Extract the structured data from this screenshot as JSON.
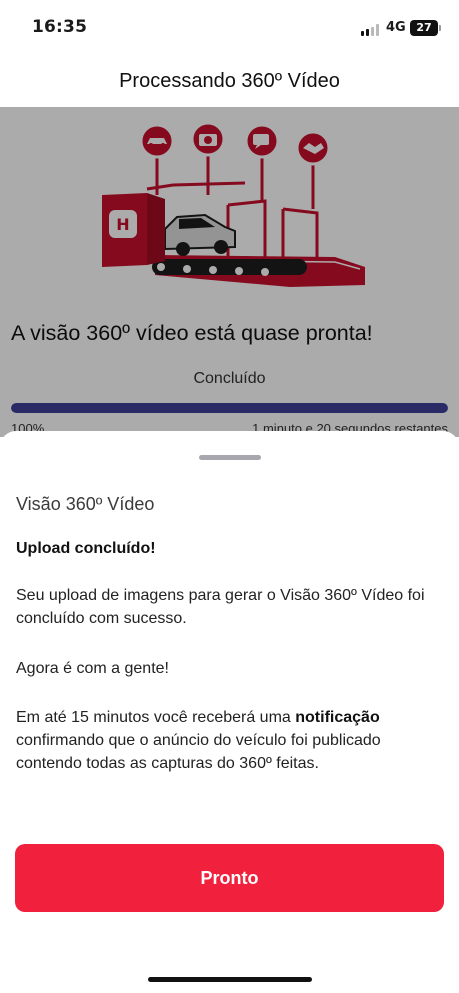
{
  "status_bar": {
    "time": "16:35",
    "network": "4G",
    "battery": "27"
  },
  "header": {
    "title": "Processando 360º Vídeo"
  },
  "processing": {
    "headline": "A visão 360º vídeo está quase pronta!",
    "status": "Concluído",
    "progress_fraction": 1.0,
    "percent_label": "100%",
    "eta_label": "1 minuto e 20 segundos restantes",
    "illustration_icons": [
      "car-icon",
      "camera-icon",
      "chat-icon",
      "handshake-icon"
    ]
  },
  "sheet": {
    "title": "Visão 360º Vídeo",
    "subtitle": "Upload concluído!",
    "paragraph_1": "Seu upload de imagens para gerar o Visão 360º Vídeo foi concluído com sucesso.",
    "paragraph_2": "Agora é com a gente!",
    "paragraph_3_prefix": "Em até 15 minutos você receberá uma ",
    "paragraph_3_bold": "notificação",
    "paragraph_3_suffix": " confirmando que o anúncio do veículo foi publicado contendo todas as capturas do 360º feitas.",
    "button_label": "Pronto"
  },
  "colors": {
    "brand_red": "#f1213e",
    "progress_fill": "#3f3f9a",
    "illustration_red": "#c8102e"
  }
}
